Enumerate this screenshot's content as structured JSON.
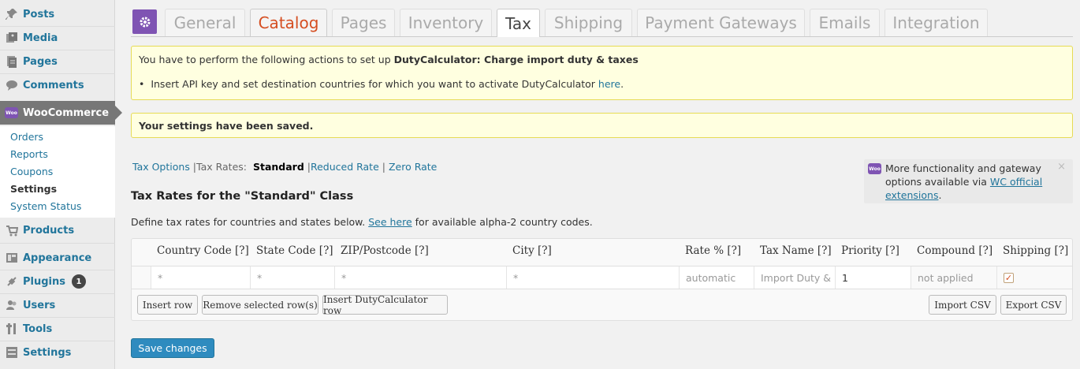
{
  "sidebar": {
    "items": [
      {
        "label": "Posts",
        "icon": "pushpin-icon"
      },
      {
        "label": "Media",
        "icon": "media-icon"
      },
      {
        "label": "Pages",
        "icon": "pages-icon"
      },
      {
        "label": "Comments",
        "icon": "comments-icon"
      }
    ],
    "woocommerce": {
      "label": "WooCommerce",
      "logo_text": "Woo"
    },
    "submenu": [
      "Orders",
      "Reports",
      "Coupons",
      "Settings",
      "System Status"
    ],
    "bottom_items": [
      {
        "label": "Products",
        "icon": "products-icon"
      },
      {
        "label": "Appearance",
        "icon": "appearance-icon"
      },
      {
        "label": "Plugins",
        "icon": "plugins-icon",
        "badge": "1"
      },
      {
        "label": "Users",
        "icon": "users-icon"
      },
      {
        "label": "Tools",
        "icon": "tools-icon"
      },
      {
        "label": "Settings",
        "icon": "settings-icon"
      }
    ]
  },
  "tabs": [
    "General",
    "Catalog",
    "Pages",
    "Inventory",
    "Tax",
    "Shipping",
    "Payment Gateways",
    "Emails",
    "Integration"
  ],
  "active_tab": "Tax",
  "notices": {
    "setup_prefix": "You have to perform the following actions to set up ",
    "setup_bold": "DutyCalculator: Charge import duty & taxes",
    "setup_item": "Insert API key and set destination countries for which you want to activate DutyCalculator ",
    "setup_link": "here",
    "setup_suffix": ".",
    "saved": "Your settings have been saved."
  },
  "subnav": {
    "tax_options": "Tax Options",
    "sep1": " |Tax Rates: ",
    "standard": "Standard",
    "sep2": " |",
    "reduced": "Reduced Rate",
    "sep3": " | ",
    "zero": "Zero Rate"
  },
  "side_notice": {
    "logo_text": "Woo",
    "text": "More functionality and gateway options available via ",
    "link": "WC official extensions",
    "suffix": ".",
    "close": "×"
  },
  "heading": "Tax Rates for the \"Standard\" Class",
  "description": {
    "prefix": "Define tax rates for countries and states below. ",
    "link": "See here",
    "suffix": " for available alpha-2 country codes."
  },
  "table": {
    "headers": [
      "Country Code  [?]",
      "State Code  [?]",
      "ZIP/Postcode  [?]",
      "City  [?]",
      "Rate %  [?]",
      "Tax Name  [?]",
      "Priority  [?]",
      "Compound  [?]",
      "Shipping  [?]"
    ],
    "row": {
      "country": "*",
      "state": "*",
      "zip": "*",
      "city": "*",
      "rate": "automatic",
      "tax_name": "Import Duty &",
      "priority": "1",
      "compound": "not applied",
      "shipping_checked": true
    }
  },
  "buttons": {
    "insert_row": "Insert row",
    "remove_rows": "Remove selected row(s)",
    "insert_duty": "Insert DutyCalculator row",
    "import_csv": "Import CSV",
    "export_csv": "Export CSV",
    "save": "Save changes"
  }
}
